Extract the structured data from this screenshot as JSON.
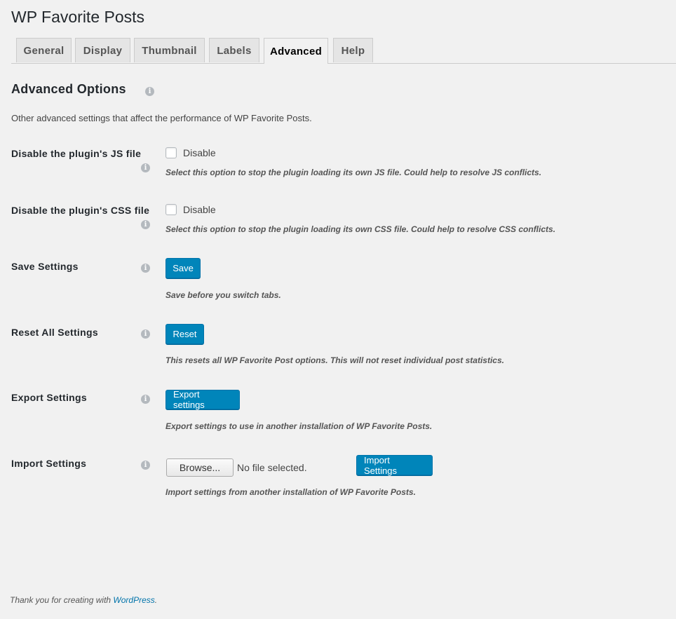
{
  "page": {
    "title": "WP Favorite Posts"
  },
  "tabs": [
    {
      "label": "General"
    },
    {
      "label": "Display"
    },
    {
      "label": "Thumbnail"
    },
    {
      "label": "Labels"
    },
    {
      "label": "Advanced",
      "active": true
    },
    {
      "label": "Help"
    }
  ],
  "section": {
    "title": "Advanced Options",
    "description": "Other advanced settings that affect the performance of WP Favorite Posts."
  },
  "settings": {
    "disable_js": {
      "label": "Disable the plugin's JS file",
      "checkbox_label": "Disable",
      "checked": false,
      "description": "Select this option to stop the plugin loading its own JS file. Could help to resolve JS conflicts."
    },
    "disable_css": {
      "label": "Disable the plugin's CSS file",
      "checkbox_label": "Disable",
      "checked": false,
      "description": "Select this option to stop the plugin loading its own CSS file. Could help to resolve CSS conflicts."
    },
    "save": {
      "label": "Save Settings",
      "button": "Save",
      "description": "Save before you switch tabs."
    },
    "reset": {
      "label": "Reset All Settings",
      "button": "Reset",
      "description": "This resets all WP Favorite Post options. This will not reset individual post statistics."
    },
    "export": {
      "label": "Export Settings",
      "button": "Export settings",
      "description": "Export settings to use in another installation of WP Favorite Posts."
    },
    "import": {
      "label": "Import Settings",
      "browse_button": "Browse...",
      "file_status": "No file selected.",
      "button": "Import Settings",
      "description": "Import settings from another installation of WP Favorite Posts."
    }
  },
  "footer": {
    "text_before": "Thank you for creating with",
    "link": "WordPress",
    "text_after": "."
  },
  "colors": {
    "background": "#f1f1f1",
    "primary_button": "#0085ba",
    "link": "#0073aa"
  }
}
